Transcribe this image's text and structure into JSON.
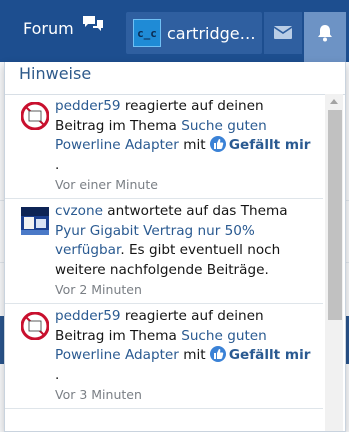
{
  "nav": {
    "forum_label": "Forum",
    "username": "cartridge…",
    "avatar_text": "c_c"
  },
  "panel": {
    "title": "Hinweise"
  },
  "notifications": [
    {
      "user": "pedder59",
      "text1": " reagierte auf deinen Beitrag im Thema ",
      "thread": "Suche guten Powerline Adapter",
      "text2": " mit ",
      "reaction": "Gefällt mir",
      "trail": ".",
      "time": "Vor einer Minute",
      "avatar": "plc-icon"
    },
    {
      "user": "cvzone",
      "text1": " antwortete auf das Thema ",
      "thread": "Pyur Gigabit Vertrag nur 50% verfügbar",
      "text2": ". Es gibt eventuell noch weitere nachfolgende Beiträge.",
      "time": "Vor 2 Minuten",
      "avatar": "cvzone-avatar"
    },
    {
      "user": "pedder59",
      "text1": " reagierte auf deinen Beitrag im Thema ",
      "thread": "Suche guten Powerline Adapter",
      "text2": " mit ",
      "reaction": "Gefällt mir",
      "trail": ".",
      "time": "Vor 3 Minuten",
      "avatar": "plc-icon"
    }
  ],
  "colors": {
    "nav_bg": "#1d4e8f",
    "link": "#2a5a91",
    "like_icon": "#3b82d6"
  }
}
